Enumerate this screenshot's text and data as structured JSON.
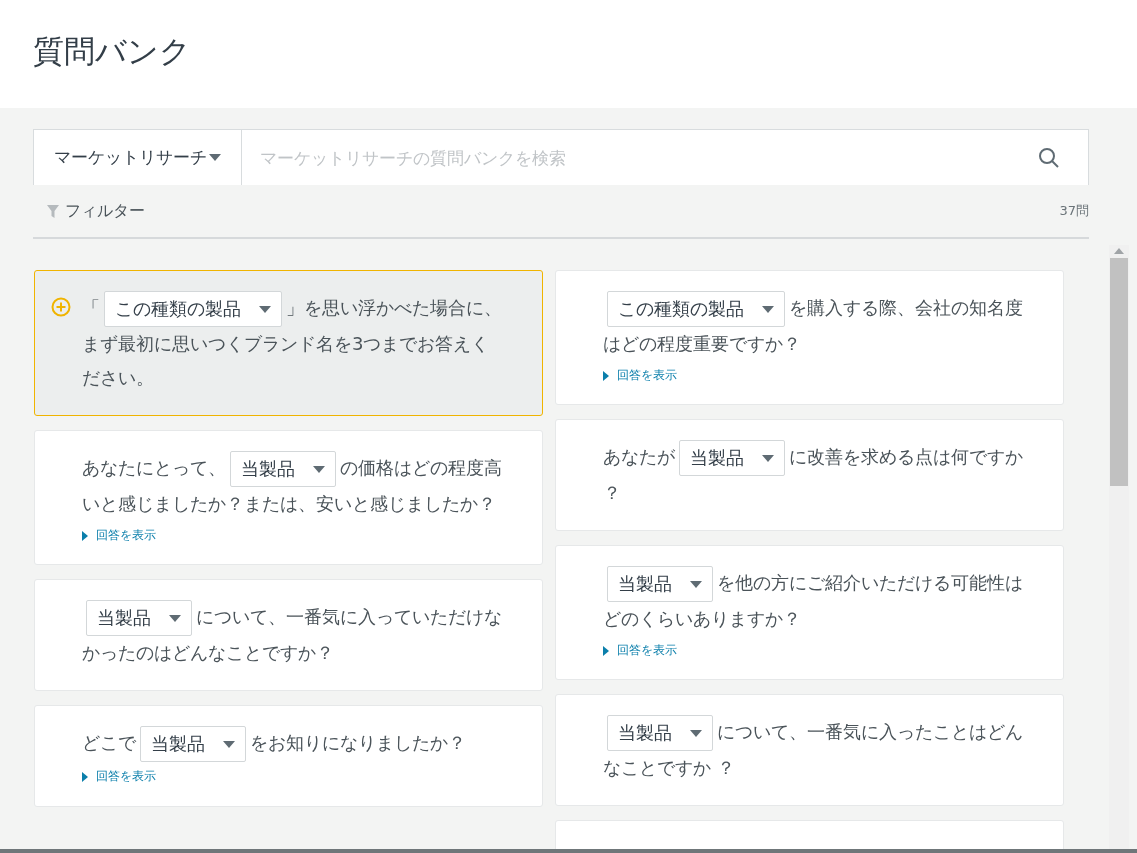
{
  "title": "質問バンク",
  "search": {
    "category": "マーケットリサーチ",
    "placeholder": "マーケットリサーチの質問バンクを検索"
  },
  "filter": {
    "label": "フィルター",
    "count": "37問"
  },
  "columns": [
    {
      "questions": [
        {
          "selected": true,
          "parts": [
            {
              "kind": "text",
              "text": "「"
            },
            {
              "kind": "select",
              "text": "この種類の製品"
            },
            {
              "kind": "text",
              "text": "」を思い浮かべた場合に、まず最初に思いつくブランド名を3つまでお答えください。"
            }
          ]
        },
        {
          "selected": false,
          "parts": [
            {
              "kind": "text",
              "text": "あなたにとって、"
            },
            {
              "kind": "select",
              "text": "当製品"
            },
            {
              "kind": "text",
              "text": "の価格はどの程度高いと感じましたか？または、安いと感じましたか？"
            }
          ],
          "answers_link": "回答を表示"
        },
        {
          "selected": false,
          "parts": [
            {
              "kind": "select",
              "text": "当製品"
            },
            {
              "kind": "text",
              "text": "について、一番気に入っていただけなかったのはどんなことですか？"
            }
          ]
        },
        {
          "selected": false,
          "parts": [
            {
              "kind": "text",
              "text": "どこで"
            },
            {
              "kind": "select",
              "text": "当製品"
            },
            {
              "kind": "text",
              "text": "をお知りになりましたか？"
            }
          ],
          "answers_link": "回答を表示"
        }
      ]
    },
    {
      "questions": [
        {
          "selected": false,
          "parts": [
            {
              "kind": "select",
              "text": "この種類の製品"
            },
            {
              "kind": "text",
              "text": "を購入する際、会社の知名度はどの程度重要ですか？"
            }
          ],
          "answers_link": "回答を表示"
        },
        {
          "selected": false,
          "parts": [
            {
              "kind": "text",
              "text": "あなたが"
            },
            {
              "kind": "select",
              "text": "当製品"
            },
            {
              "kind": "text",
              "text": "に改善を求める点は何ですか？"
            }
          ]
        },
        {
          "selected": false,
          "parts": [
            {
              "kind": "select",
              "text": "当製品"
            },
            {
              "kind": "text",
              "text": "を他の方にご紹介いただける可能性はどのくらいありますか？"
            }
          ],
          "answers_link": "回答を表示"
        },
        {
          "selected": false,
          "parts": [
            {
              "kind": "select",
              "text": "当製品"
            },
            {
              "kind": "text",
              "text": "について、一番気に入ったことはどんなことですか ？"
            }
          ]
        },
        {
          "selected": false
        }
      ]
    }
  ]
}
